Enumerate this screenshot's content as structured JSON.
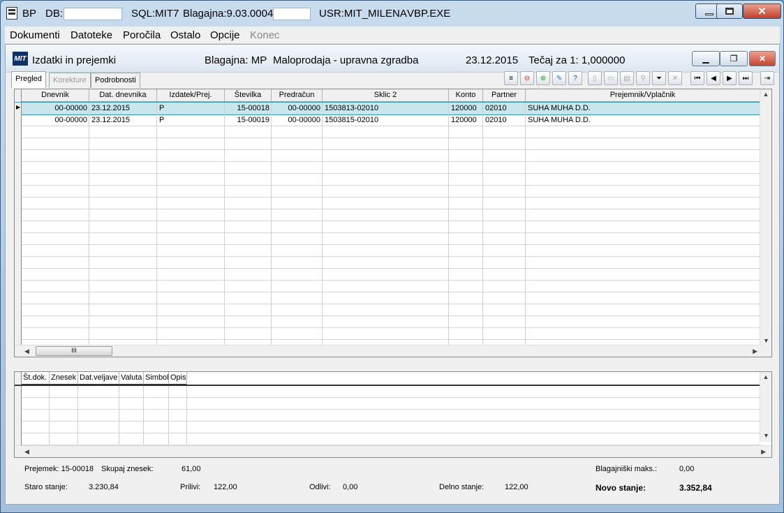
{
  "window": {
    "app": "BP",
    "db_label": "DB:S",
    "sql": "SQL:MIT7",
    "blagajna_version": "Blagajna:9.03.0004",
    "user": "USR:MIT_MILENA",
    "exe": "VBP.EXE"
  },
  "menu": [
    {
      "label": "Dokumenti",
      "disabled": false
    },
    {
      "label": "Datoteke",
      "disabled": false
    },
    {
      "label": "Poročila",
      "disabled": false
    },
    {
      "label": "Ostalo",
      "disabled": false
    },
    {
      "label": "Opcije",
      "disabled": false
    },
    {
      "label": "Konec",
      "disabled": true
    }
  ],
  "child": {
    "logo": "MIT",
    "title": "Izdatki in prejemki",
    "blagajna": "Blagajna: MP",
    "location": "Maloprodaja - upravna zgradba",
    "date": "23.12.2015",
    "rate": "Tečaj za 1: 1,000000"
  },
  "tabs": [
    {
      "label": "Pregled",
      "state": "active"
    },
    {
      "label": "Korekture",
      "state": "disabled"
    },
    {
      "label": "Podrobnosti",
      "state": "normal"
    }
  ],
  "grid": {
    "columns": [
      "Dnevnik",
      "Dat. dnevnika",
      "Izdatek/Prej.",
      "Številka",
      "Predračun",
      "Sklic 2",
      "Konto",
      "Partner",
      "Prejemnik/Vplačnik"
    ],
    "rows": [
      [
        "00-00000",
        "23.12.2015",
        "P",
        "15-00018",
        "00-00000",
        "1503813-02010",
        "120000",
        "02010",
        "SUHA MUHA D.D."
      ],
      [
        "00-00000",
        "23.12.2015",
        "P",
        "15-00019",
        "00-00000",
        "1503815-02010",
        "120000",
        "02010",
        "SUHA MUHA D.D."
      ]
    ],
    "hscroll_thumb": "III"
  },
  "detail_grid": {
    "columns": [
      "Št.dok.",
      "Znesek",
      "Dat.veljave",
      "Valuta",
      "Simbol",
      "Opis"
    ]
  },
  "footer": {
    "prejemek": "Prejemek: 15-00018",
    "skupaj_label": "Skupaj znesek:",
    "skupaj_value": "61,00",
    "maks_label": "Blagajniški maks.:",
    "maks_value": "0,00",
    "staro_label": "Staro stanje:",
    "staro_value": "3.230,84",
    "prilivi_label": "Prilivi:",
    "prilivi_value": "122,00",
    "odlivi_label": "Odlivi:",
    "odlivi_value": "0,00",
    "delno_label": "Delno stanje:",
    "delno_value": "122,00",
    "novo_label": "Novo stanje:",
    "novo_value": "3.352,84"
  },
  "colors": {
    "accent": "#3a9ab8",
    "close": "#c4442e"
  }
}
